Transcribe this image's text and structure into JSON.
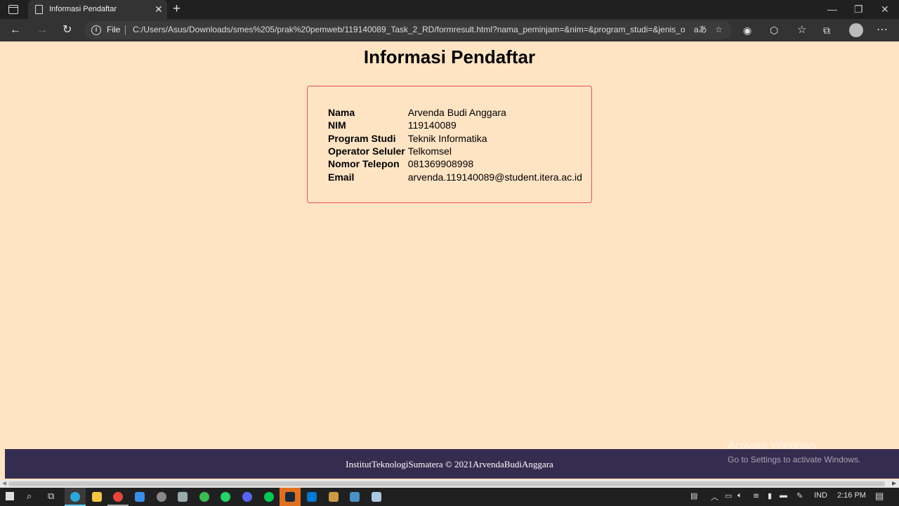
{
  "browser": {
    "tab_title": "Informasi Pendaftar",
    "address_prefix": "File",
    "url": "C:/Users/Asus/Downloads/smes%205/prak%20pemweb/119140089_Task_2_RD/formresult.html?nama_peminjam=&nim=&program_studi=&jenis_oper..."
  },
  "page": {
    "title": "Informasi Pendaftar",
    "fields": [
      {
        "label": "Nama",
        "value": "Arvenda Budi Anggara"
      },
      {
        "label": "NIM",
        "value": "119140089"
      },
      {
        "label": "Program Studi",
        "value": "Teknik Informatika"
      },
      {
        "label": "Operator Seluler",
        "value": "Telkomsel"
      },
      {
        "label": "Nomor Telepon",
        "value": "081369908998"
      },
      {
        "label": "Email",
        "value": "arvenda.119140089@student.itera.ac.id"
      }
    ],
    "footer": "InstitutTeknologiSumatera © 2021ArvendaBudiAnggara"
  },
  "watermark": {
    "line1": "Activate Windows",
    "line2": "Go to Settings to activate Windows."
  },
  "taskbar": {
    "language": "IND",
    "time": "2:16 PM"
  },
  "colors": {
    "page_background": "#ffe4c4",
    "card_border": "#e35252",
    "footer_background": "#352d4f"
  }
}
